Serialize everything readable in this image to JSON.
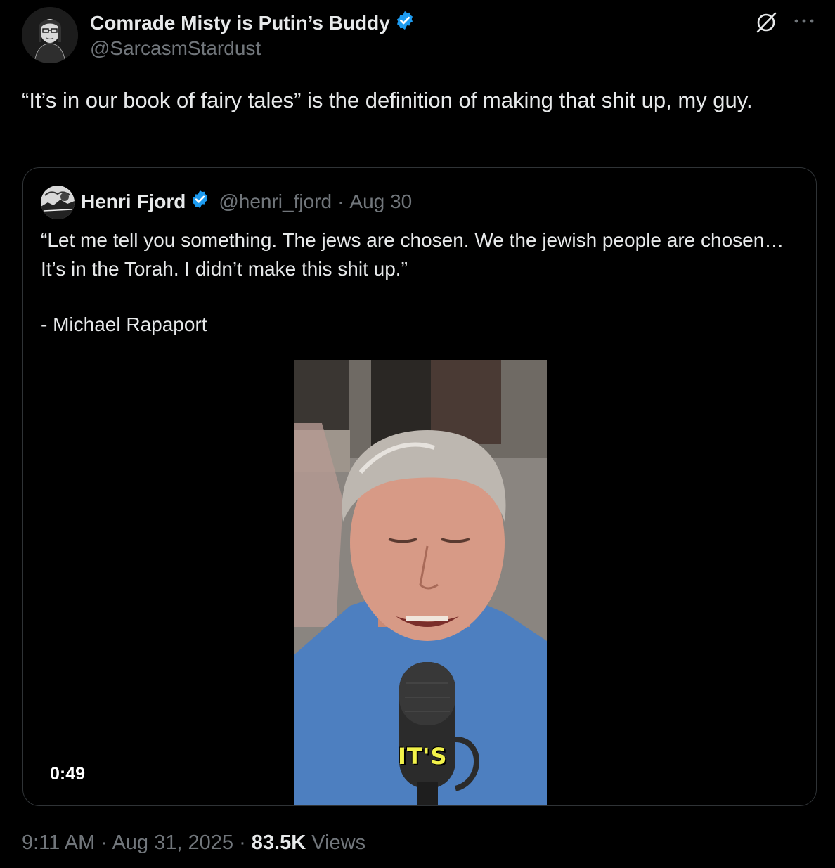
{
  "tweet": {
    "author": {
      "display_name": "Comrade Misty is Putin’s Buddy",
      "handle": "@SarcasmStardust",
      "verified": true
    },
    "text": "“It’s in our book of fairy tales” is the definition of making that shit up, my guy.",
    "icons": {
      "grok": "grok-icon",
      "more": "more-options-icon",
      "verified": "verified-badge-icon"
    },
    "timestamp": "9:11 AM",
    "date": "Aug 31, 2025",
    "views_count": "83.5K",
    "views_label": "Views",
    "separator": "·"
  },
  "quote": {
    "author": {
      "display_name": "Henri Fjord",
      "handle": "@henri_fjord",
      "verified": true
    },
    "date": "Aug 30",
    "separator": "·",
    "text_line1": "“Let me tell you something. The jews are chosen. We the jewish people are chosen…It’s in the Torah. I didn’t make this shit up.”",
    "text_line2": "- Michael Rapaport",
    "video": {
      "caption": "IT'S",
      "duration": "0:49"
    }
  },
  "colors": {
    "background": "#000000",
    "text_primary": "#e7e9ea",
    "text_secondary": "#71767b",
    "border": "#2f3336",
    "verified_blue": "#1d9bf0",
    "caption_yellow": "#f2f24a"
  }
}
